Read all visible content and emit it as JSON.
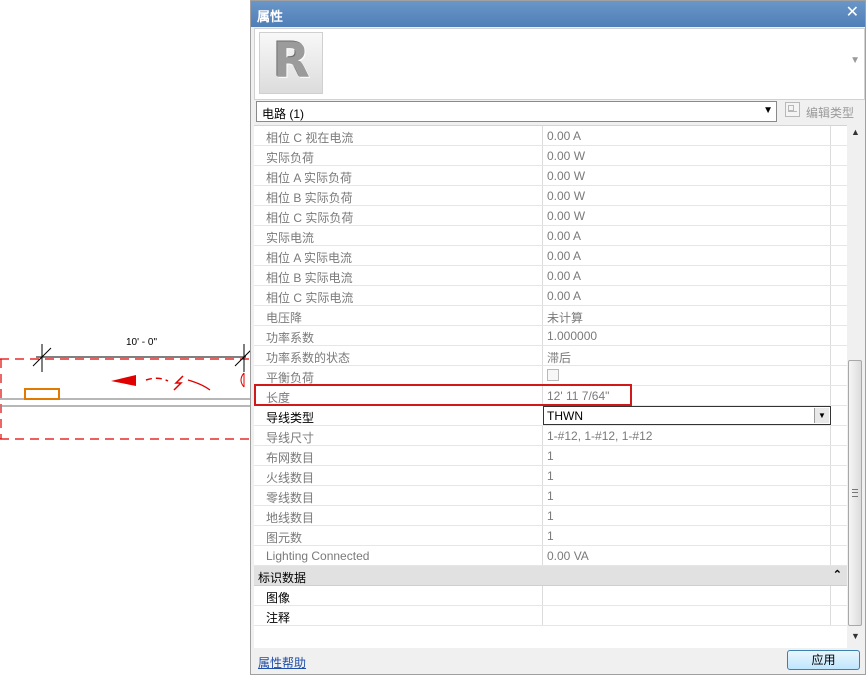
{
  "drawing": {
    "dimension_label": "10' - 0\""
  },
  "palette": {
    "title": "属性",
    "close_symbol": "✕",
    "type_thumbnail_letter": "R",
    "expand_arrow": "▼",
    "instance_selector": "电路 (1)",
    "edit_type_label": "编辑类型"
  },
  "properties": {
    "rows": [
      {
        "name": "相位 C 视在电流",
        "value": "0.00 A"
      },
      {
        "name": "实际负荷",
        "value": "0.00 W"
      },
      {
        "name": "相位 A 实际负荷",
        "value": "0.00 W"
      },
      {
        "name": "相位 B 实际负荷",
        "value": "0.00 W"
      },
      {
        "name": "相位 C 实际负荷",
        "value": "0.00 W"
      },
      {
        "name": "实际电流",
        "value": "0.00 A"
      },
      {
        "name": "相位 A 实际电流",
        "value": "0.00 A"
      },
      {
        "name": "相位 B 实际电流",
        "value": "0.00 A"
      },
      {
        "name": "相位 C 实际电流",
        "value": "0.00 A"
      },
      {
        "name": "电压降",
        "value": "未计算"
      },
      {
        "name": "功率系数",
        "value": "1.000000"
      },
      {
        "name": "功率系数的状态",
        "value": "滞后"
      },
      {
        "name": "平衡负荷",
        "value": ""
      },
      {
        "name": "长度",
        "value": "12'  11 7/64\""
      },
      {
        "name": "导线类型",
        "value": "THWN"
      },
      {
        "name": "导线尺寸",
        "value": "1-#12, 1-#12, 1-#12"
      },
      {
        "name": "布网数目",
        "value": "1"
      },
      {
        "name": "火线数目",
        "value": "1"
      },
      {
        "name": "零线数目",
        "value": "1"
      },
      {
        "name": "地线数目",
        "value": "1"
      },
      {
        "name": "图元数",
        "value": "1"
      },
      {
        "name": "Lighting Connected",
        "value": "0.00 VA"
      }
    ],
    "group_identity": {
      "label": "标识数据",
      "collapse_symbol": "⌃",
      "rows": [
        {
          "name": "图像",
          "value": ""
        },
        {
          "name": "注释",
          "value": ""
        }
      ]
    }
  },
  "footer": {
    "help_link": "属性帮助",
    "apply_button": "应用"
  },
  "colors": {
    "highlight": "#d01919",
    "title_bar": "#4f7fb8",
    "circuit_red": "#e00000",
    "device_orange": "#e07a00"
  }
}
